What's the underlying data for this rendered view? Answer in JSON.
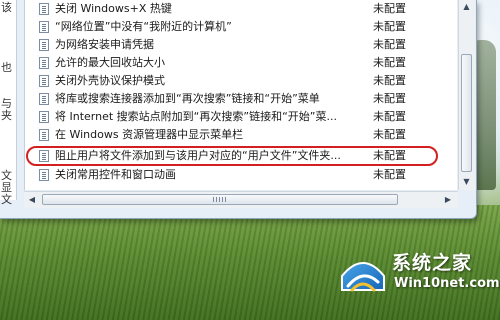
{
  "left_pane_fragments": [
    "该",
    "",
    "也",
    "与",
    "夹",
    "",
    "",
    "",
    "",
    "文",
    "显",
    "文"
  ],
  "policies": [
    {
      "name": "关闭 Windows+X 热键",
      "state": "未配置"
    },
    {
      "name": "“网络位置”中没有“我附近的计算机”",
      "state": "未配置"
    },
    {
      "name": "为网络安装申请凭据",
      "state": "未配置"
    },
    {
      "name": "允许的最大回收站大小",
      "state": "未配置"
    },
    {
      "name": "关闭外壳协议保护模式",
      "state": "未配置"
    },
    {
      "name": "将库或搜索连接器添加到“再次搜索”链接和“开始”菜单",
      "state": "未配置"
    },
    {
      "name": "将 Internet 搜索站点附加到“再次搜索”链接和“开始”菜...",
      "state": "未配置"
    },
    {
      "name": "在 Windows 资源管理器中显示菜单栏",
      "state": "未配置"
    },
    {
      "name": "阻止用户将文件添加到与该用户对应的“用户文件”文件夹...",
      "state": "未配置"
    },
    {
      "name": "关闭常用控件和窗口动画",
      "state": "未配置"
    }
  ],
  "highlighted_index": 8,
  "highlight_color": "#d41f1f",
  "scrollbar": {
    "up": "▲",
    "down": "▼",
    "left": "◀",
    "right": "▶"
  },
  "watermark": {
    "title": "系统之家",
    "subtitle": "Win10net.com"
  }
}
